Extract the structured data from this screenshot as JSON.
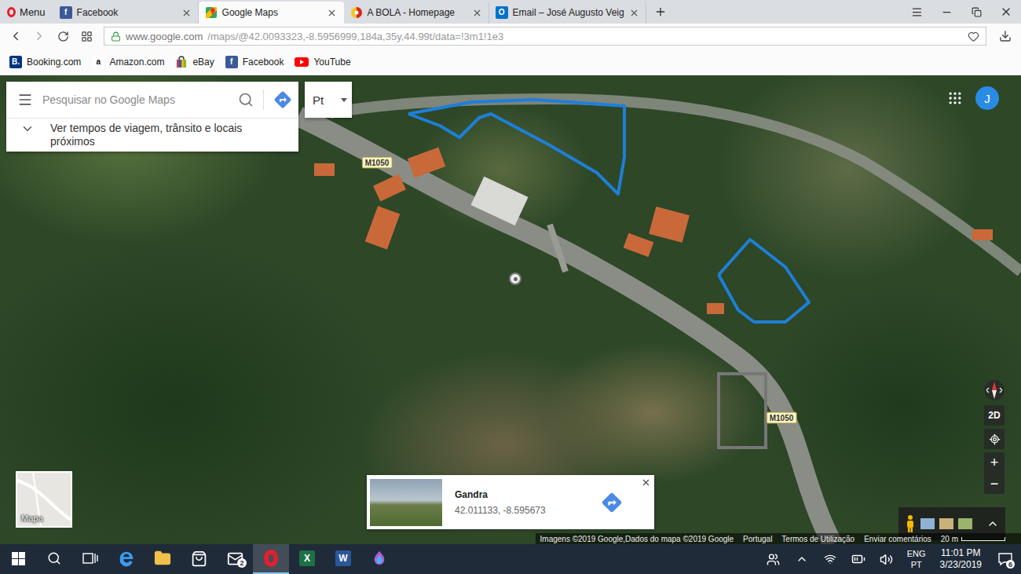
{
  "browser": {
    "menu": {
      "label": "Menu"
    },
    "tabs": [
      {
        "label": "Facebook",
        "selected": false,
        "kind": "facebook",
        "glyph": "f"
      },
      {
        "label": "Google Maps",
        "selected": true,
        "kind": "maps",
        "glyph": ""
      },
      {
        "label": "A BOLA - Homepage",
        "selected": false,
        "kind": "abola",
        "glyph": ""
      },
      {
        "label": "Email – José Augusto Veig",
        "selected": false,
        "kind": "outlook",
        "glyph": "O"
      }
    ],
    "address": {
      "host": "www.google.com",
      "path": "/maps/@42.0093323,-8.5956999,184a,35y,44.99t/data=!3m1!1e3",
      "secure": true
    },
    "bookmarks": [
      {
        "label": "Booking.com",
        "kind": "booking",
        "glyph": "B."
      },
      {
        "label": "Amazon.com",
        "kind": "amazon",
        "glyph": "a"
      },
      {
        "label": "eBay",
        "kind": "ebay",
        "glyph": ""
      },
      {
        "label": "Facebook",
        "kind": "facebook",
        "glyph": "f"
      },
      {
        "label": "YouTube",
        "kind": "youtube",
        "glyph": ""
      }
    ]
  },
  "maps": {
    "search": {
      "placeholder": "Pesquisar no Google Maps"
    },
    "language": "Pt",
    "nearby": "Ver tempos de viagem, trânsito e locais próximos",
    "account": "J",
    "road_labels": [
      "M1050",
      "M1050"
    ],
    "place_card": {
      "title": "Gandra",
      "coords": "42.011133, -8.595673"
    },
    "controls": {
      "view": "2D",
      "zoom_in": "+",
      "zoom_out": "−"
    },
    "minimap": "Mapa",
    "footer": [
      "Imagens ©2019 Google,Dados do mapa ©2019 Google",
      "Portugal",
      "Termos de Utilização",
      "Enviar comentários"
    ],
    "scale": "20 m"
  },
  "taskbar": {
    "apps": [
      {
        "name": "edge",
        "active": false,
        "badge": "",
        "glyph": ""
      },
      {
        "name": "explorer",
        "active": false,
        "badge": "",
        "glyph": ""
      },
      {
        "name": "store",
        "active": false,
        "badge": "",
        "glyph": ""
      },
      {
        "name": "mail",
        "active": false,
        "badge": "2",
        "glyph": ""
      },
      {
        "name": "opera",
        "active": true,
        "badge": "",
        "glyph": ""
      },
      {
        "name": "excel",
        "active": false,
        "badge": "",
        "glyph": "X"
      },
      {
        "name": "word",
        "active": false,
        "badge": "",
        "glyph": "W"
      },
      {
        "name": "paint3d",
        "active": false,
        "badge": "",
        "glyph": ""
      }
    ],
    "language": {
      "input": "ENG",
      "layout": "PT"
    },
    "time": "11:01 PM",
    "date": "3/23/2019",
    "notifications": "6"
  }
}
